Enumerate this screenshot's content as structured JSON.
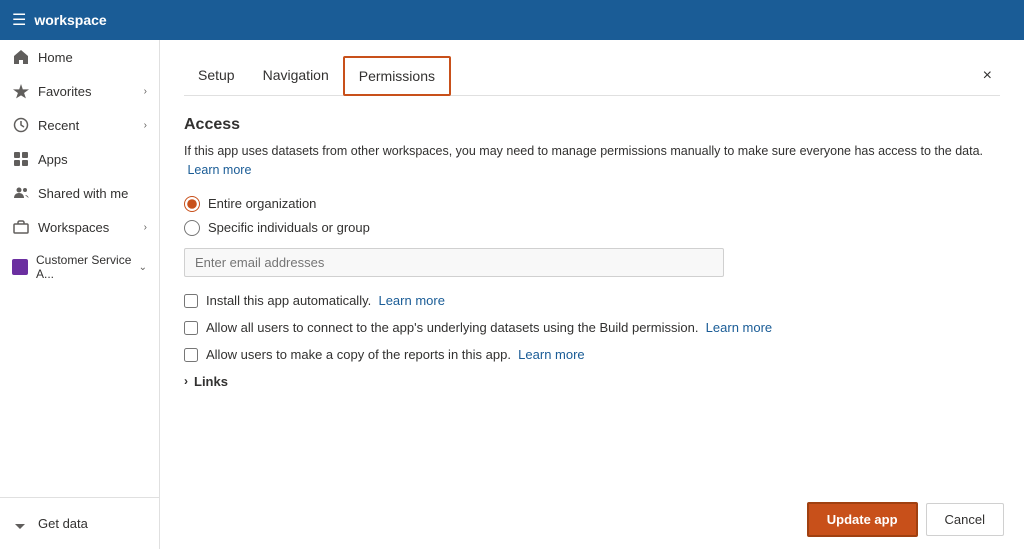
{
  "topbar": {
    "title": "workspace"
  },
  "sidebar": {
    "items": [
      {
        "id": "home",
        "label": "Home",
        "icon": "home"
      },
      {
        "id": "favorites",
        "label": "Favorites",
        "icon": "star",
        "hasChevron": true
      },
      {
        "id": "recent",
        "label": "Recent",
        "icon": "clock",
        "hasChevron": true
      },
      {
        "id": "apps",
        "label": "Apps",
        "icon": "grid"
      },
      {
        "id": "shared",
        "label": "Shared with me",
        "icon": "people"
      },
      {
        "id": "workspaces",
        "label": "Workspaces",
        "icon": "briefcase",
        "hasChevron": true
      },
      {
        "id": "customer",
        "label": "Customer Service A...",
        "icon": "workspace-purple",
        "hasChevron": true
      }
    ],
    "bottom": {
      "label": "Get data",
      "icon": "arrow-up-right"
    }
  },
  "tabs": [
    {
      "id": "setup",
      "label": "Setup"
    },
    {
      "id": "navigation",
      "label": "Navigation"
    },
    {
      "id": "permissions",
      "label": "Permissions",
      "active": true
    }
  ],
  "panel": {
    "close_label": "×",
    "access": {
      "title": "Access",
      "description": "If this app uses datasets from other workspaces, you may need to manage permissions manually to make sure everyone has access to the data.",
      "learn_more_1": "Learn more",
      "radio_options": [
        {
          "id": "entire-org",
          "label": "Entire organization",
          "checked": true
        },
        {
          "id": "specific-individuals",
          "label": "Specific individuals or group",
          "checked": false
        }
      ],
      "email_placeholder": "Enter email addresses",
      "checkboxes": [
        {
          "id": "install-auto",
          "label": "Install this app automatically.",
          "learn_more": "Learn more"
        },
        {
          "id": "allow-build",
          "label": "Allow all users to connect to the app's underlying datasets using the Build permission.",
          "learn_more": "Learn more"
        },
        {
          "id": "allow-copy",
          "label": "Allow users to make a copy of the reports in this app.",
          "learn_more": "Learn more"
        }
      ]
    },
    "links_label": "Links",
    "buttons": {
      "update": "Update app",
      "cancel": "Cancel"
    }
  }
}
